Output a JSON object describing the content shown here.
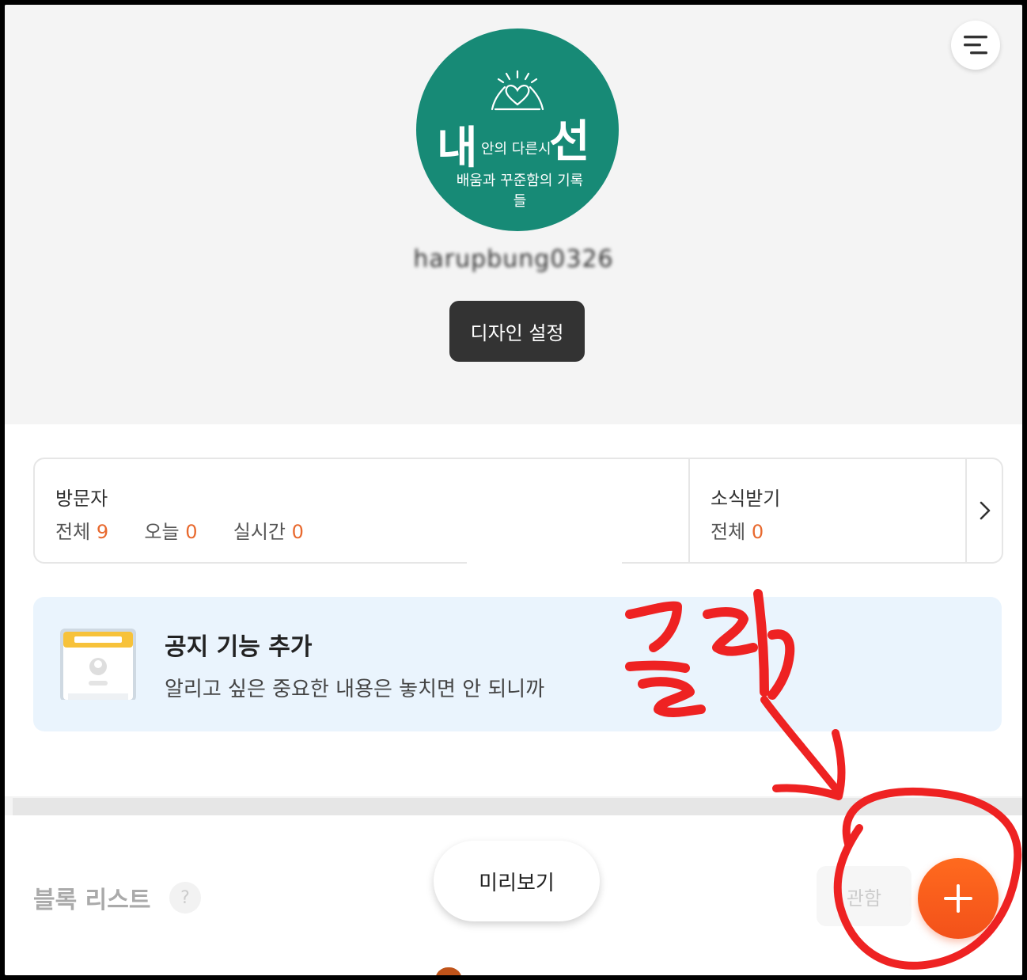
{
  "header": {
    "logo": {
      "big_left": "내",
      "small": "안의 다른시",
      "big_right": "선",
      "subtitle": "배움과 꾸준함의 기록들"
    },
    "username": "harupbung0326",
    "design_button": "디자인 설정",
    "menu_icon": "hamburger-menu-icon"
  },
  "stats": {
    "visitors": {
      "title": "방문자",
      "total_label": "전체",
      "total_value": "9",
      "today_label": "오늘",
      "today_value": "0",
      "realtime_label": "실시간",
      "realtime_value": "0"
    },
    "subscribers": {
      "title": "소식받기",
      "total_label": "전체",
      "total_value": "0"
    },
    "next_icon": "chevron-right-icon"
  },
  "notice": {
    "title": "공지 기능 추가",
    "description": "알리고 싶은 중요한 내용은 놓치면 안 되니까",
    "icon": "notice-card-icon"
  },
  "bottom": {
    "block_list_title": "블록 리스트",
    "help_label": "?",
    "preview_button": "미리보기",
    "close_button": "관함",
    "add_icon": "plus-icon"
  },
  "annotation": {
    "text": "클릭",
    "color": "#ee2222"
  },
  "colors": {
    "accent": "#e8692e",
    "logo_bg": "#178a76",
    "add_button": "#f65a1c"
  }
}
